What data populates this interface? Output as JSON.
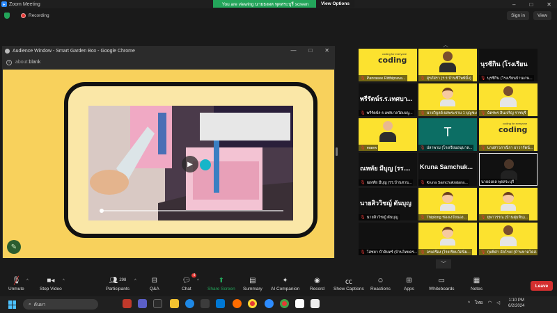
{
  "titlebar": {
    "app_title": "Zoom Meeting",
    "banner_text": "You are viewing นายธงผล พุดสระบุรี screen",
    "view_options": "View Options",
    "minimize": "–",
    "maximize": "□",
    "close": "✕"
  },
  "meeting_bar": {
    "recording": "Recording",
    "signin": "Sign in",
    "view": "View"
  },
  "chrome": {
    "title": "Audience Window - Smart Garden Box - Google Chrome",
    "url_prefix": "about:",
    "url_main": "blank",
    "minimize": "—",
    "maximize": "□",
    "close": "✕"
  },
  "gallery": {
    "tiles": [
      {
        "name": "Panrasee Ritthiprava...",
        "muted": true
      },
      {
        "name": "สุรภัสรา (ร.ร.บ้านซิโพพ์มิ่ง)",
        "muted": true
      },
      {
        "name": "นุรซีกิน (โรงเรียนบ้านเกษ...",
        "big": "นุรซีกิน (โรงเรียน",
        "muted": true
      },
      {
        "name": "พรีรัตน์ร.ร.เทศบาลวัดเบญ...",
        "big": "พรีรัตน์ร.ร.เทศบา...",
        "muted": true
      },
      {
        "name": "นายวิบูลย์ ผลพระราม 1 บุญชะเริ่ม...",
        "muted": true
      },
      {
        "name": "ฉัตรพร สินเจริญ ราชบุรี",
        "muted": true
      },
      {
        "name": "maew",
        "muted": true
      },
      {
        "name": "ปลาพาม (โรงเรียนอนุบาล...",
        "muted": true
      },
      {
        "name": "นางสาวภาณิรา ยาวารัตน์...",
        "muted": true
      },
      {
        "name": "ณหทัย มีบุญ (รร.บ้านสวน...",
        "big": "ณหทัย มีบุญ (รร....",
        "muted": true
      },
      {
        "name": "Kruna Samchukratana...",
        "big": "Kruna Samchuk...",
        "muted": true
      },
      {
        "name": "นายธงผล พุดสระบุรี",
        "muted": false
      },
      {
        "name": "นายสิววิชญ์ ตันบุญ",
        "big": "นายสิววิชญ์ ตันบุญ",
        "muted": true
      },
      {
        "name": "Thiplong ชองเงวัยนอง...",
        "muted": true
      },
      {
        "name": "ยุพาวรรณ (บ้านตุ่มหิน)...",
        "muted": true
      },
      {
        "name": "โสชยา ปำจันทร์ (บ้านไทยคร...",
        "muted": true
      },
      {
        "name": "อรเครือง (โรงเรียนวัดนิม...",
        "muted": true
      },
      {
        "name": "กุมพิศา อัลโรเย่ (บ้านหาดโคส...",
        "muted": true
      }
    ],
    "teal_letter": "T",
    "coding_word": "coding",
    "coding_sub": "coding for everyone",
    "up_arrow": "︿",
    "down_arrow": "﹀"
  },
  "toolbar": {
    "unmute": "Unmute",
    "stop_video": "Stop Video",
    "participants": "Participants",
    "participants_count": "298",
    "qa": "Q&A",
    "chat": "Chat",
    "chat_badge": "4",
    "share_screen": "Share Screen",
    "summary": "Summary",
    "ai_companion": "AI Companion",
    "record": "Record",
    "show_captions": "Show Captions",
    "reactions": "Reactions",
    "apps": "Apps",
    "whiteboards": "Whiteboards",
    "notes": "Notes",
    "leave": "Leave"
  },
  "taskbar": {
    "search_placeholder": "ค้นหา",
    "lang": "ไทย",
    "time": "1:10 PM",
    "date": "6/2/2024"
  },
  "colors": {
    "accent_green": "#23a55a",
    "leave_red": "#d32f2f",
    "tile_yellow": "#fce22f",
    "slide_bg": "#f8d15c"
  }
}
